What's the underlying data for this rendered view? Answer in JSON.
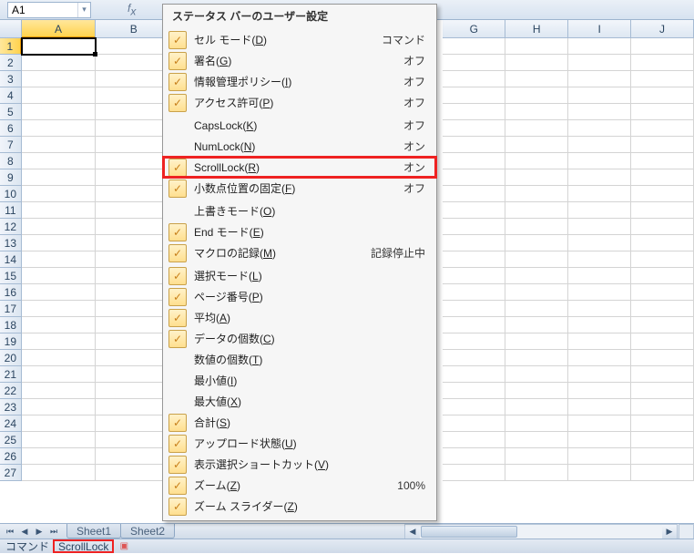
{
  "namebox": {
    "value": "A1"
  },
  "columns": [
    "A",
    "B",
    "G",
    "H",
    "I",
    "J"
  ],
  "colWidthsLeft": [
    83,
    85
  ],
  "colWidthRight": 70,
  "rows": 27,
  "selected": {
    "row": 1,
    "col": "A"
  },
  "sheets": [
    "Sheet1",
    "Sheet2"
  ],
  "status": {
    "mode": "コマンド",
    "lock": "ScrollLock"
  },
  "menu": {
    "title": "ステータス バーのユーザー設定",
    "items": [
      {
        "checked": true,
        "label": "セル モード",
        "accel": "D",
        "value": "コマンド"
      },
      {
        "checked": true,
        "label": "署名",
        "accel": "G",
        "value": "オフ"
      },
      {
        "checked": true,
        "label": "情報管理ポリシー",
        "accel": "I",
        "value": "オフ"
      },
      {
        "checked": true,
        "label": "アクセス許可",
        "accel": "P",
        "value": "オフ"
      },
      {
        "checked": false,
        "label": "CapsLock",
        "accel": "K",
        "value": "オフ"
      },
      {
        "checked": false,
        "label": "NumLock",
        "accel": "N",
        "value": "オン"
      },
      {
        "checked": true,
        "label": "ScrollLock",
        "accel": "R",
        "value": "オン",
        "highlight": true
      },
      {
        "checked": true,
        "label": "小数点位置の固定",
        "accel": "F",
        "value": "オフ"
      },
      {
        "checked": false,
        "label": "上書きモード",
        "accel": "O",
        "value": ""
      },
      {
        "checked": true,
        "label": "End モード",
        "accel": "E",
        "value": ""
      },
      {
        "checked": true,
        "label": "マクロの記録",
        "accel": "M",
        "value": "記録停止中"
      },
      {
        "checked": true,
        "label": "選択モード",
        "accel": "L",
        "value": ""
      },
      {
        "checked": true,
        "label": "ページ番号",
        "accel": "P",
        "value": ""
      },
      {
        "checked": true,
        "label": "平均",
        "accel": "A",
        "value": ""
      },
      {
        "checked": true,
        "label": "データの個数",
        "accel": "C",
        "value": ""
      },
      {
        "checked": false,
        "label": "数値の個数",
        "accel": "T",
        "value": ""
      },
      {
        "checked": false,
        "label": "最小値",
        "accel": "I",
        "value": ""
      },
      {
        "checked": false,
        "label": "最大値",
        "accel": "X",
        "value": ""
      },
      {
        "checked": true,
        "label": "合計",
        "accel": "S",
        "value": ""
      },
      {
        "checked": true,
        "label": "アップロード状態",
        "accel": "U",
        "value": ""
      },
      {
        "checked": true,
        "label": "表示選択ショートカット",
        "accel": "V",
        "value": ""
      },
      {
        "checked": true,
        "label": "ズーム",
        "accel": "Z",
        "value": "100%"
      },
      {
        "checked": true,
        "label": "ズーム スライダー",
        "accel": "Z",
        "value": ""
      }
    ]
  }
}
